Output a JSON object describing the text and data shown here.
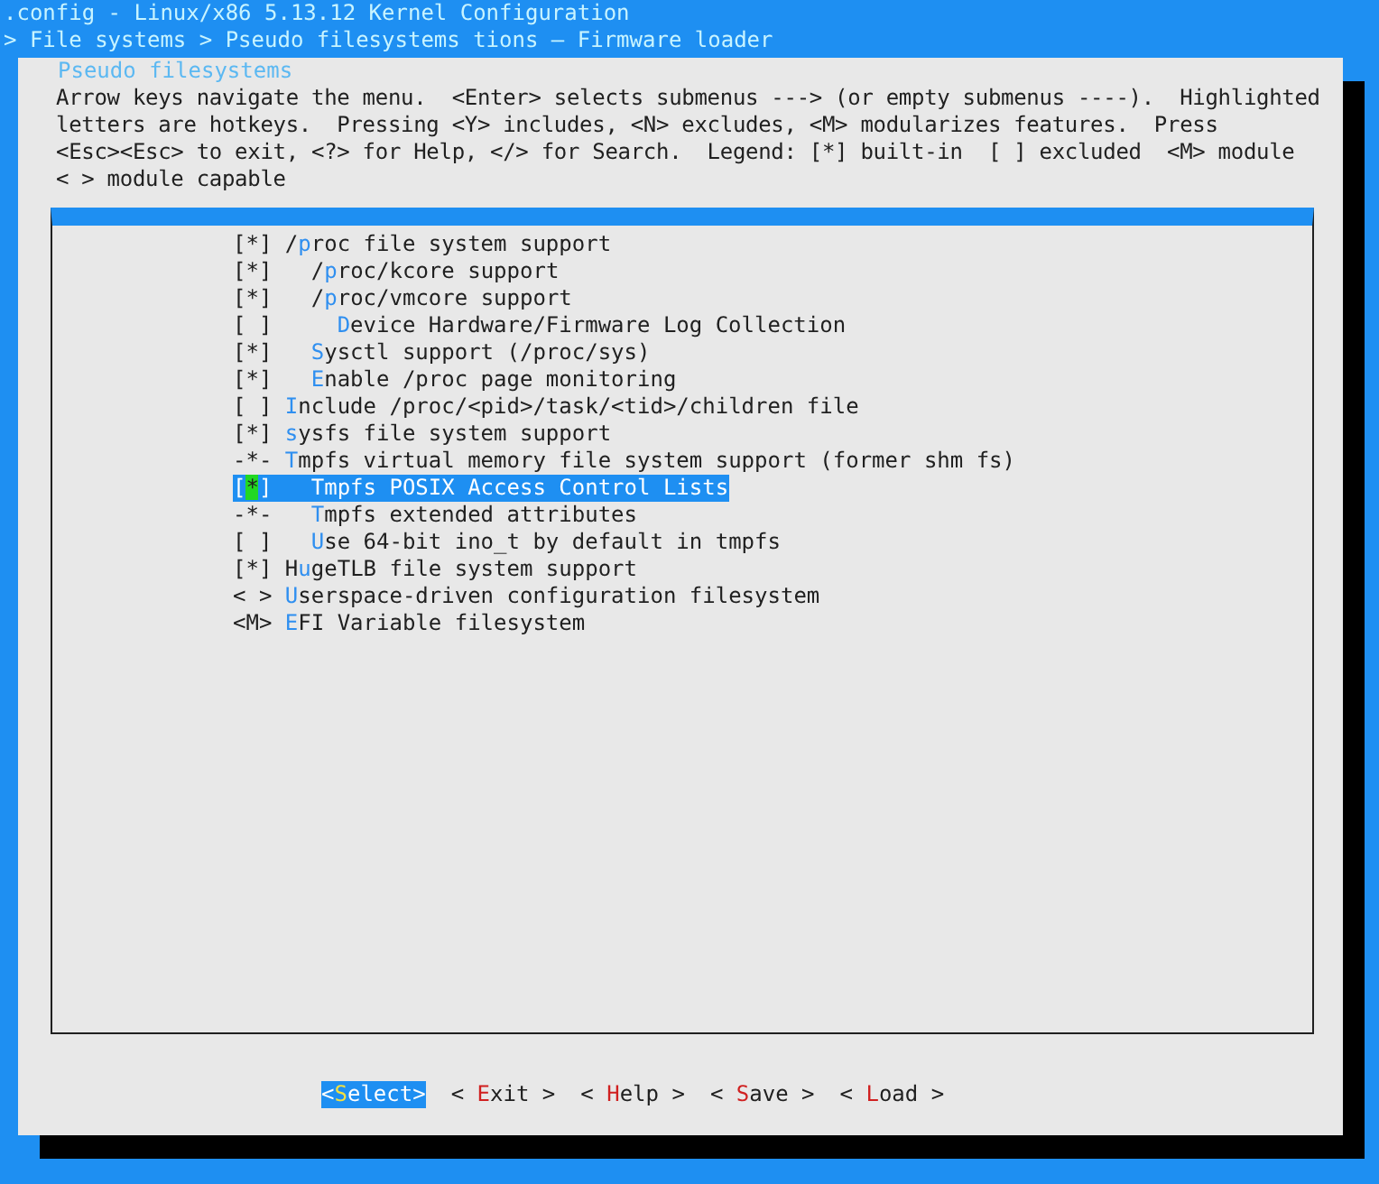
{
  "header": {
    "title": ".config - Linux/x86 5.13.12 Kernel Configuration",
    "breadcrumb": "> File systems > Pseudo filesystems tions — Firmware loader"
  },
  "dialog": {
    "title": "Pseudo filesystems",
    "help": [
      "Arrow keys navigate the menu.  <Enter> selects submenus ---> (or empty submenus ----).  Highlighted",
      "letters are hotkeys.  Pressing <Y> includes, <N> excludes, <M> modularizes features.  Press",
      "<Esc><Esc> to exit, <?> for Help, </> for Search.  Legend: [*] built-in  [ ] excluded  <M> module",
      "< > module capable"
    ],
    "items": [
      {
        "prefix": "[*]",
        "lead": "/",
        "hotkey": "p",
        "rest": "roc file system support",
        "selected": false,
        "children": [
          {
            "prefix": "[*]",
            "lead": "/",
            "hotkey": "p",
            "rest": "roc/kcore support",
            "selected": false
          },
          {
            "prefix": "[*]",
            "lead": "/",
            "hotkey": "p",
            "rest": "roc/vmcore support",
            "selected": false,
            "children": [
              {
                "prefix": "[ ]",
                "hotkey": "D",
                "rest": "evice Hardware/Firmware Log Collection",
                "selected": false
              }
            ]
          },
          {
            "prefix": "[*]",
            "hotkey": "S",
            "rest": "ysctl support (/proc/sys)",
            "selected": false
          },
          {
            "prefix": "[*]",
            "hotkey": "E",
            "rest": "nable /proc page monitoring",
            "selected": false
          }
        ]
      },
      {
        "prefix": "[ ]",
        "hotkey": "I",
        "rest": "nclude /proc/<pid>/task/<tid>/children file",
        "selected": false
      },
      {
        "prefix": "[*]",
        "hotkey": "s",
        "rest": "ysfs file system support",
        "selected": false
      },
      {
        "prefix": "-*-",
        "hotkey": "T",
        "rest": "mpfs virtual memory file system support (former shm fs)",
        "selected": false,
        "children": [
          {
            "prefix": "[*]",
            "hotkey": "T",
            "rest": "mpfs POSIX Access Control Lists",
            "selected": true
          },
          {
            "prefix": "-*-",
            "hotkey": "T",
            "rest": "mpfs extended attributes",
            "selected": false
          },
          {
            "prefix": "[ ]",
            "hotkey": "U",
            "rest": "se 64-bit ino_t by default in tmpfs",
            "selected": false
          }
        ]
      },
      {
        "prefix": "[*]",
        "lead": "H",
        "hotkey": "u",
        "rest": "geTLB file system support",
        "selected": false
      },
      {
        "prefix": "< >",
        "hotkey": "U",
        "rest": "serspace-driven configuration filesystem",
        "selected": false
      },
      {
        "prefix": "<M>",
        "hotkey": "E",
        "rest": "FI Variable filesystem",
        "selected": false
      }
    ],
    "buttons": [
      {
        "lead": "<",
        "hotkey": "S",
        "rest": "elect>",
        "selected": true
      },
      {
        "lead": "< ",
        "hotkey": "E",
        "rest": "xit >",
        "selected": false
      },
      {
        "lead": "< ",
        "hotkey": "H",
        "rest": "elp >",
        "selected": false
      },
      {
        "lead": "< ",
        "hotkey": "S",
        "rest": "ave >",
        "selected": false
      },
      {
        "lead": "< ",
        "hotkey": "L",
        "rest": "oad >",
        "selected": false
      }
    ]
  }
}
